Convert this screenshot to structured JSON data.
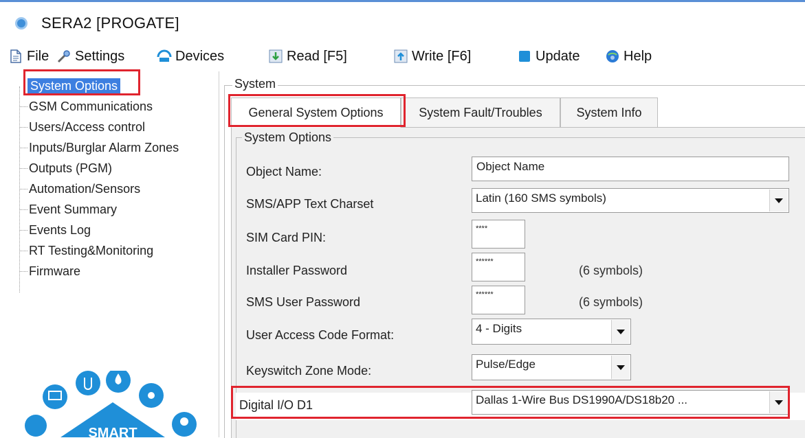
{
  "window": {
    "title": "SERA2 [PROGATE]"
  },
  "toolbar": {
    "items": [
      {
        "label": "File",
        "icon": "file-icon"
      },
      {
        "label": "Settings",
        "icon": "settings-icon"
      },
      {
        "label": "Devices",
        "icon": "devices-icon"
      },
      {
        "label": "Read [F5]",
        "icon": "read-icon"
      },
      {
        "label": "Write [F6]",
        "icon": "write-icon"
      },
      {
        "label": "Update",
        "icon": "update-icon"
      },
      {
        "label": "Help",
        "icon": "help-icon"
      }
    ]
  },
  "sidebar": {
    "items": [
      {
        "label": "System Options",
        "selected": true
      },
      {
        "label": "GSM Communications"
      },
      {
        "label": "Users/Access control"
      },
      {
        "label": "Inputs/Burglar Alarm Zones"
      },
      {
        "label": "Outputs (PGM)"
      },
      {
        "label": "Automation/Sensors"
      },
      {
        "label": "Event Summary"
      },
      {
        "label": "Events Log"
      },
      {
        "label": "RT Testing&Monitoring"
      },
      {
        "label": "Firmware"
      }
    ],
    "logo_text": "SMART"
  },
  "main": {
    "group_title": "System",
    "tabs": [
      {
        "label": "General System Options",
        "active": true
      },
      {
        "label": "System Fault/Troubles"
      },
      {
        "label": "System Info"
      }
    ],
    "section_title": "System Options",
    "fields": {
      "object_name": {
        "label": "Object Name:",
        "value": "Object Name"
      },
      "sms_charset": {
        "label": "SMS/APP Text Charset",
        "value": "Latin (160 SMS symbols)"
      },
      "sim_pin": {
        "label": "SIM Card PIN:",
        "value": "****"
      },
      "installer_password": {
        "label": "Installer Password",
        "value": "******",
        "hint": "(6 symbols)"
      },
      "sms_user_password": {
        "label": "SMS User Password",
        "value": "******",
        "hint": "(6 symbols)"
      },
      "access_code_format": {
        "label": "User Access Code Format:",
        "value": "4 - Digits"
      },
      "keyswitch_mode": {
        "label": "Keyswitch Zone Mode:",
        "value": "Pulse/Edge"
      },
      "digital_io": {
        "label": "Digital I/O D1",
        "value": "Dallas 1-Wire Bus  DS1990A/DS18b20 ..."
      }
    }
  },
  "colors": {
    "highlight": "#e0242e",
    "selection": "#3d7fe0"
  }
}
